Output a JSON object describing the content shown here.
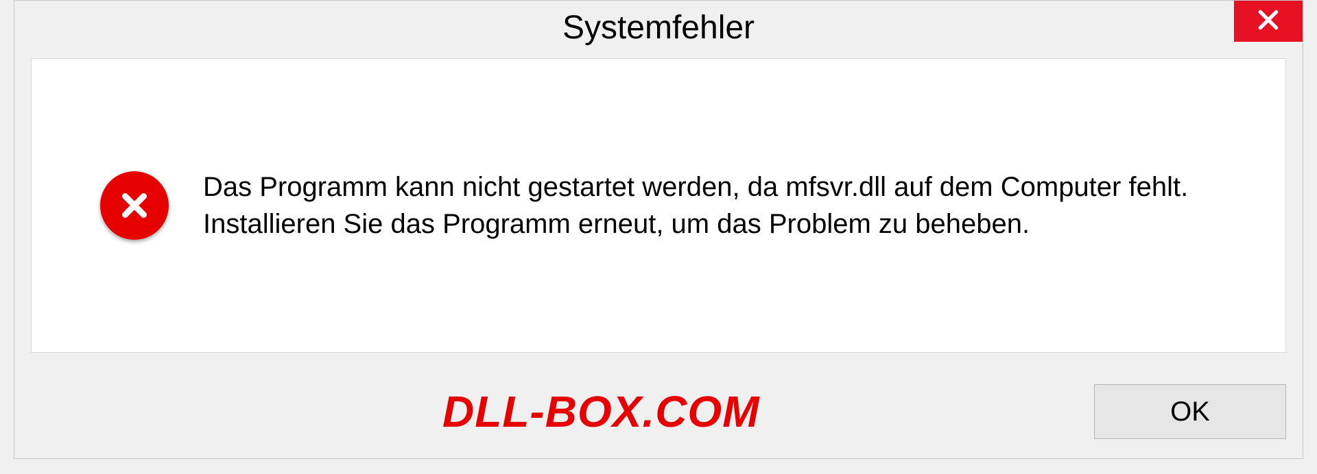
{
  "dialog": {
    "title": "Systemfehler",
    "message": "Das Programm kann nicht gestartet werden, da mfsvr.dll auf dem Computer fehlt. Installieren Sie das Programm erneut, um das Problem zu beheben.",
    "ok_label": "OK"
  },
  "watermark": "DLL-BOX.COM",
  "colors": {
    "error_red": "#e60000",
    "close_red": "#e81123"
  }
}
